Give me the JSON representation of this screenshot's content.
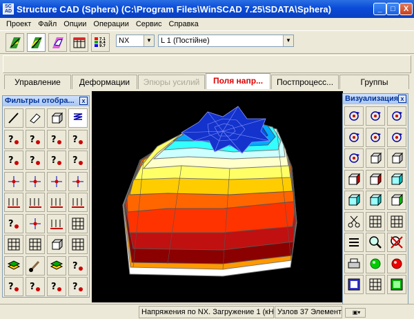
{
  "window": {
    "title": "Structure CAD (Sphera) (C:\\Program Files\\WinSCAD 7.25\\SDATA\\Sphera)",
    "app_icon": "scad-app-icon",
    "min_label": "_",
    "max_label": "□",
    "close_label": "X"
  },
  "menu": [
    "Проект",
    "Файл",
    "Опции",
    "Операции",
    "Сервис",
    "Справка"
  ],
  "toolbar": {
    "combo_component": "NX",
    "combo_load": "L 1 (Постійне)"
  },
  "tabs": [
    {
      "label": "Управление",
      "state": "normal"
    },
    {
      "label": "Деформации",
      "state": "normal"
    },
    {
      "label": "Эпюры усилий",
      "state": "disabled"
    },
    {
      "label": "Поля напр...",
      "state": "active"
    },
    {
      "label": "Постпроцесс...",
      "state": "normal"
    },
    {
      "label": "Группы",
      "state": "normal"
    }
  ],
  "filters_panel": {
    "title": "Фильтры отобра...",
    "close": "x"
  },
  "viz_panel": {
    "title": "Визуализация",
    "close": "x"
  },
  "status": {
    "message": "Напряжения по NX. Загружение 1 (кН",
    "counts": "Узлов 37 Элементо"
  },
  "colors": {
    "title_blue": "#0a4bd8",
    "active_tab_red": "#dd0000",
    "viewport_bg": "#000000"
  }
}
